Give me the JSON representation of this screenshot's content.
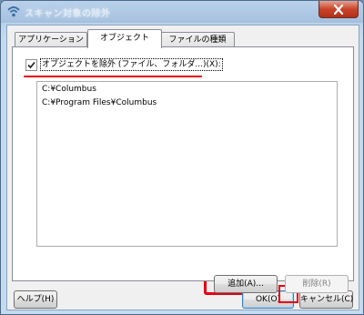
{
  "window": {
    "title": "スキャン対象の除外",
    "close_symbol": "✕"
  },
  "tabs": [
    {
      "label": "アプリケーション",
      "active": false
    },
    {
      "label": "オブジェクト",
      "active": true
    },
    {
      "label": "ファイルの種類",
      "active": false
    }
  ],
  "objects_panel": {
    "exclude_checkbox": {
      "label": "オブジェクトを除外 (ファイル、フォルダ...)(X):",
      "checked": true
    },
    "excluded_paths": [
      "C:¥Columbus",
      "C:¥Program Files¥Columbus"
    ],
    "add_button": "追加(A)...",
    "remove_button": "削除(R)"
  },
  "footer": {
    "help_button": "ヘルプ(H)",
    "ok_button": "OK(O)",
    "cancel_button": "キャンセル(C)"
  },
  "colors": {
    "highlight_red": "#e60012",
    "title_gradient_top": "#b9d1ea",
    "close_button": "#c9432b"
  },
  "icons": {
    "app": "wifi-shield-icon",
    "close": "close-icon",
    "check": "checkmark-icon"
  }
}
